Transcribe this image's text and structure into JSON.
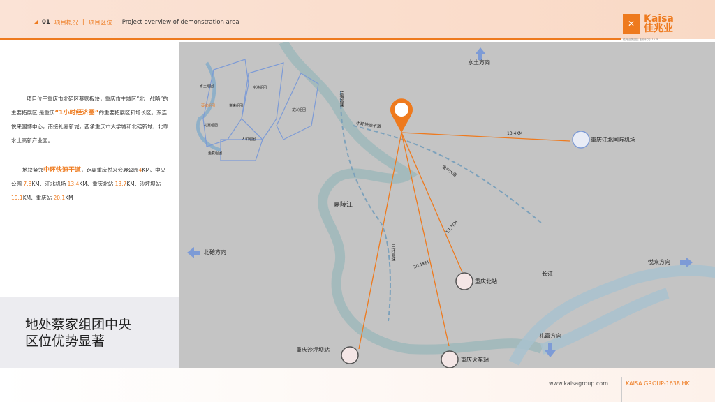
{
  "header": {
    "section_no": "01",
    "section": "项目概况",
    "sep": "|",
    "subsection": "项目区位",
    "subtitle_en": "Project overview of demonstration area"
  },
  "logo": {
    "brand_en": "Kaisa",
    "brand_cn": "佳兆业",
    "tagline": "佳兆业集团 | 股份代号 1638"
  },
  "left": {
    "para1_a": "项目位于重庆市北碚区蔡家板块，重庆市主城区“北上战略”的主要拓展区 是重庆",
    "para1_hl": "“1小时经济圈”",
    "para1_b": "的重要拓展区和增长区。东连悦来国博中心，南接礼嘉新城，西承重庆市大学城和北碚新城，北靠水土高新产业园。",
    "para2_a": "地块紧邻",
    "para2_hl": "中环快速干道",
    "para2_b": "，距离重庆悦来会展公园",
    "d1": "4",
    "d1t": "KM、中央公园 ",
    "d2": "7.8",
    "d2t": "KM、江北机场 ",
    "d3": "13.4",
    "d3t": "KM、重庆北站 ",
    "d4": "13.7",
    "d4t": "KM、沙坪坝站 ",
    "d5": "19.1",
    "d5t": "KM、重庆站 ",
    "d6": "20.1",
    "d6t": "KM",
    "slogan1": "地处蔡家组团中央",
    "slogan2": "区位优势显著"
  },
  "inset": {
    "groups": [
      "水土组团",
      "蔡家组团",
      "悦来组团",
      "空港组团",
      "礼嘉组团",
      "龙兴组团",
      "人和组团",
      "鱼复组团"
    ],
    "highlight": "蔡家组团"
  },
  "map": {
    "directions": {
      "north": "水土方向",
      "west": "北碚方向",
      "east": "悦来方向",
      "south": "礼嘉方向"
    },
    "rivers": {
      "jialing": "嘉陵江",
      "yangtze": "长江"
    },
    "roads": {
      "ring": "中环快速干道",
      "jinxing": "金兴大道",
      "lanhai": "兰海高速",
      "huanhu": "三环高速"
    },
    "destinations": {
      "airport": "重庆江北国际机场",
      "north_station": "重庆北站",
      "shapingba": "重庆沙坪坝站",
      "cq_station": "重庆火车站"
    },
    "distances": {
      "airport": "13.4KM",
      "north_station": "13.7KM",
      "cq_station": "20.1KM"
    },
    "colors": {
      "accent": "#ee7a1e",
      "river": "#9fb9bb",
      "arrow": "#7d9bd6"
    }
  },
  "footer": {
    "url": "www.kaisagroup.com",
    "code": "KAISA GROUP-1638.HK"
  }
}
